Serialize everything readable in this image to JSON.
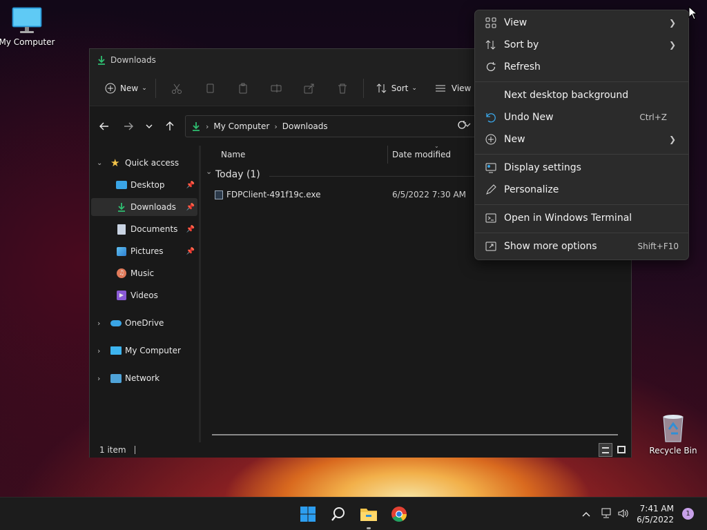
{
  "desktop": {
    "icons": [
      {
        "label": "My Computer"
      },
      {
        "label": "Recycle Bin"
      }
    ]
  },
  "window": {
    "title": "Downloads",
    "toolbar": {
      "new_label": "New",
      "sort_label": "Sort",
      "view_label": "View"
    },
    "address": {
      "crumbs": [
        "My Computer",
        "Downloads"
      ]
    },
    "sidebar": {
      "items": [
        {
          "label": "Quick access"
        },
        {
          "label": "Desktop"
        },
        {
          "label": "Downloads"
        },
        {
          "label": "Documents"
        },
        {
          "label": "Pictures"
        },
        {
          "label": "Music"
        },
        {
          "label": "Videos"
        },
        {
          "label": "OneDrive"
        },
        {
          "label": "My Computer"
        },
        {
          "label": "Network"
        }
      ]
    },
    "columns": {
      "name": "Name",
      "date": "Date modified"
    },
    "group": {
      "label": "Today (1)"
    },
    "files": [
      {
        "name": "FDPClient-491f19c.exe",
        "date": "6/5/2022 7:30 AM"
      }
    ],
    "status": "1 item"
  },
  "context_menu": {
    "items": [
      {
        "label": "View",
        "shortcut": "",
        "submenu": true
      },
      {
        "label": "Sort by",
        "shortcut": "",
        "submenu": true
      },
      {
        "label": "Refresh",
        "shortcut": ""
      },
      {
        "label": "Next desktop background",
        "shortcut": ""
      },
      {
        "label": "Undo New",
        "shortcut": "Ctrl+Z"
      },
      {
        "label": "New",
        "shortcut": "",
        "submenu": true
      },
      {
        "label": "Display settings",
        "shortcut": ""
      },
      {
        "label": "Personalize",
        "shortcut": ""
      },
      {
        "label": "Open in Windows Terminal",
        "shortcut": ""
      },
      {
        "label": "Show more options",
        "shortcut": "Shift+F10"
      }
    ]
  },
  "taskbar": {
    "time": "7:41 AM",
    "date": "6/5/2022",
    "notification_count": "1"
  },
  "colors": {
    "accent": "#3aa5e6",
    "download_green": "#2fbf71",
    "folder_yellow": "#f3c44a"
  }
}
